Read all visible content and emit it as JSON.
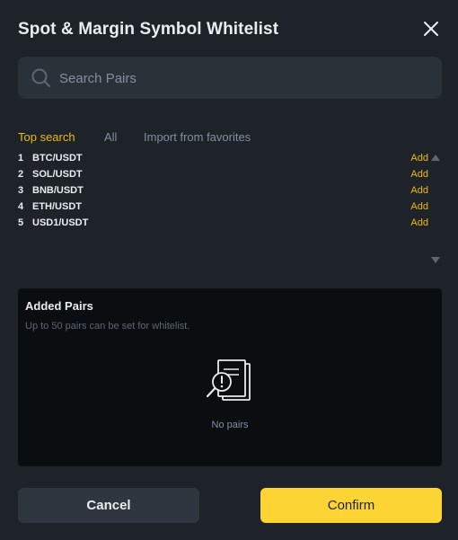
{
  "dialog": {
    "title": "Spot & Margin Symbol Whitelist"
  },
  "search": {
    "placeholder": "Search Pairs",
    "value": ""
  },
  "tabs": [
    {
      "label": "Top search",
      "active": true
    },
    {
      "label": "All",
      "active": false
    },
    {
      "label": "Import from favorites",
      "active": false
    }
  ],
  "pairs": [
    {
      "rank": "1",
      "symbol": "BTC/USDT",
      "action": "Add"
    },
    {
      "rank": "2",
      "symbol": "SOL/USDT",
      "action": "Add"
    },
    {
      "rank": "3",
      "symbol": "BNB/USDT",
      "action": "Add"
    },
    {
      "rank": "4",
      "symbol": "ETH/USDT",
      "action": "Add"
    },
    {
      "rank": "5",
      "symbol": "USD1/USDT",
      "action": "Add"
    }
  ],
  "added": {
    "title": "Added Pairs",
    "subtitle": "Up to 50 pairs can be set for whitelist.",
    "empty_text": "No pairs"
  },
  "buttons": {
    "cancel": "Cancel",
    "confirm": "Confirm"
  },
  "colors": {
    "accent": "#f0b90b",
    "confirm_bg": "#fcd535",
    "dialog_bg": "#1e2329"
  }
}
